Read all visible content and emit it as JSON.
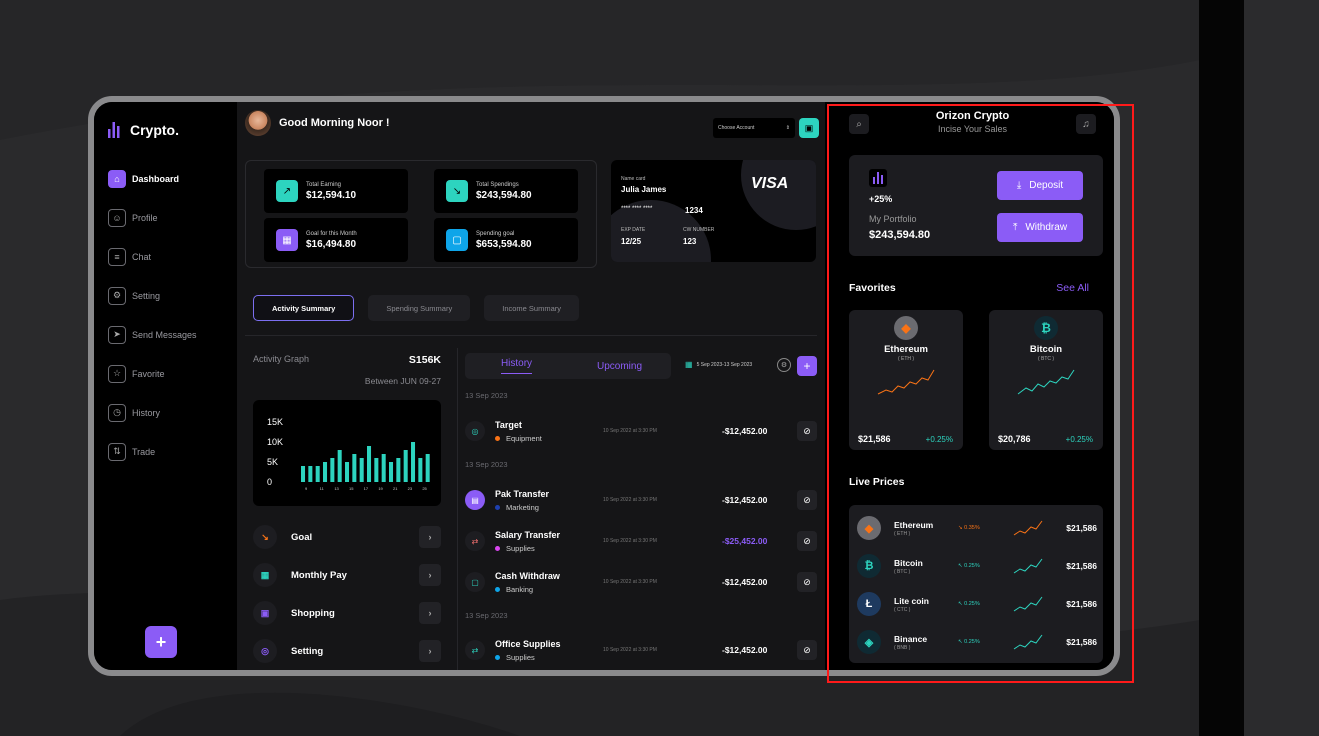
{
  "sidebar": {
    "logo": "Crypto.",
    "items": [
      {
        "label": "Dashboard",
        "icon": "home-icon"
      },
      {
        "label": "Profile",
        "icon": "user-icon"
      },
      {
        "label": "Chat",
        "icon": "chat-icon"
      },
      {
        "label": "Setting",
        "icon": "gear-icon"
      },
      {
        "label": "Send Messages",
        "icon": "send-icon"
      },
      {
        "label": "Favorite",
        "icon": "star-icon"
      },
      {
        "label": "History",
        "icon": "clock-icon"
      },
      {
        "label": "Trade",
        "icon": "trade-icon"
      }
    ],
    "add_label": "+"
  },
  "header": {
    "greeting": "Good Morning Noor !",
    "choose_account": "Choose Account"
  },
  "stats": [
    {
      "label": "Total Earning",
      "value": "$12,594.10",
      "color": "#2dd4bf"
    },
    {
      "label": "Total Spendings",
      "value": "$243,594.80",
      "color": "#2dd4bf"
    },
    {
      "label": "Goal for this Month",
      "value": "$16,494.80",
      "color": "#8b5cf6"
    },
    {
      "label": "Spending goal",
      "value": "$653,594.80",
      "color": "#38bdf8"
    }
  ],
  "card": {
    "name_label": "Name card",
    "name": "Julia James",
    "brand": "VISA",
    "number_mask": "****   ****   ****",
    "number_last": "1234",
    "exp_label": "EXP DATE",
    "exp": "12/25",
    "cvv_label": "CW NUMBER",
    "cvv": "123"
  },
  "tabs": [
    "Activity Summary",
    "Spending Summary",
    "Income Summary"
  ],
  "activity": {
    "title": "Activity Graph",
    "amount": "S156K",
    "range": "Between JUN 09-27",
    "y_ticks": [
      "15K",
      "10K",
      "5K",
      "0"
    ],
    "x_ticks": [
      "9",
      "11",
      "13",
      "15",
      "17",
      "19",
      "21",
      "23",
      "25"
    ]
  },
  "chart_data": {
    "type": "bar",
    "categories": [
      "9",
      "10",
      "11",
      "12",
      "13",
      "14",
      "15",
      "16",
      "17",
      "18",
      "19",
      "20",
      "21",
      "22",
      "23",
      "24",
      "25",
      "26"
    ],
    "values": [
      4,
      4,
      4,
      5,
      6,
      8,
      5,
      7,
      6,
      9,
      6,
      7,
      5,
      6,
      8,
      10,
      6,
      7
    ],
    "ylim": [
      0,
      15
    ],
    "ylabel": "",
    "xlabel": "",
    "title": ""
  },
  "quick": [
    {
      "label": "Goal",
      "icon": "goal-icon"
    },
    {
      "label": "Monthly Pay",
      "icon": "calendar-icon"
    },
    {
      "label": "Shopping",
      "icon": "bag-icon"
    },
    {
      "label": "Setting",
      "icon": "gear-icon"
    }
  ],
  "history": {
    "tab_history": "History",
    "tab_upcoming": "Upcoming",
    "date_range": "5 Sep 2023-13 Sep 2023",
    "groups": [
      "13 Sep 2023",
      "13 Sep 2023",
      "13 Sep 2023"
    ],
    "rows": [
      {
        "name": "Target",
        "category": "Equipment",
        "time": "10 Sep 2022 at 3:30 PM",
        "amount": "-$12,452.00",
        "dot": "#f97316",
        "amount_color": "#ffffff"
      },
      {
        "name": "Pak Transfer",
        "category": "Marketing",
        "time": "10 Sep 2022 at 3:30 PM",
        "amount": "-$12,452.00",
        "dot": "#1e40af",
        "amount_color": "#ffffff"
      },
      {
        "name": "Salary Transfer",
        "category": "Supplies",
        "time": "10 Sep 2022 at 3:30 PM",
        "amount": "-$25,452.00",
        "dot": "#d946ef",
        "amount_color": "#8b5cf6"
      },
      {
        "name": "Cash Withdraw",
        "category": "Banking",
        "time": "10 Sep 2022 at 3:30 PM",
        "amount": "-$12,452.00",
        "dot": "#0ea5e9",
        "amount_color": "#ffffff"
      },
      {
        "name": "Office Supplies",
        "category": "Supplies",
        "time": "10 Sep 2022 at 3:30 PM",
        "amount": "-$12,452.00",
        "dot": "#0ea5e9",
        "amount_color": "#ffffff"
      }
    ]
  },
  "right": {
    "title": "Orizon Crypto",
    "subtitle": "Incise Your Sales",
    "portfolio_change": "+25%",
    "portfolio_label": "My Portfolio",
    "portfolio_value": "$243,594.80",
    "deposit": "Deposit",
    "withdraw": "Withdraw",
    "favorites_title": "Favorites",
    "see_all": "See All",
    "favorites": [
      {
        "name": "Ethereum",
        "symbol": "( ETH )",
        "price": "$21,586",
        "change": "+0.25%",
        "line_color": "#f97316"
      },
      {
        "name": "Bitcoin",
        "symbol": "( BTC )",
        "price": "$20,786",
        "change": "+0.25%",
        "line_color": "#2dd4bf"
      }
    ],
    "live_title": "Live Prices",
    "live": [
      {
        "name": "Ethereum",
        "symbol": "( ETH )",
        "change": "↘ 0.35%",
        "price": "$21,586",
        "color": "#f97316"
      },
      {
        "name": "Bitcoin",
        "symbol": "( BTC )",
        "change": "↖ 0.25%",
        "price": "$21,586",
        "color": "#2dd4bf"
      },
      {
        "name": "Lite coin",
        "symbol": "( CTC )",
        "change": "↖ 0.25%",
        "price": "$21,586",
        "color": "#2dd4bf"
      },
      {
        "name": "Binance",
        "symbol": "( BNB )",
        "change": "↖ 0.25%",
        "price": "$21,586",
        "color": "#2dd4bf"
      }
    ]
  }
}
